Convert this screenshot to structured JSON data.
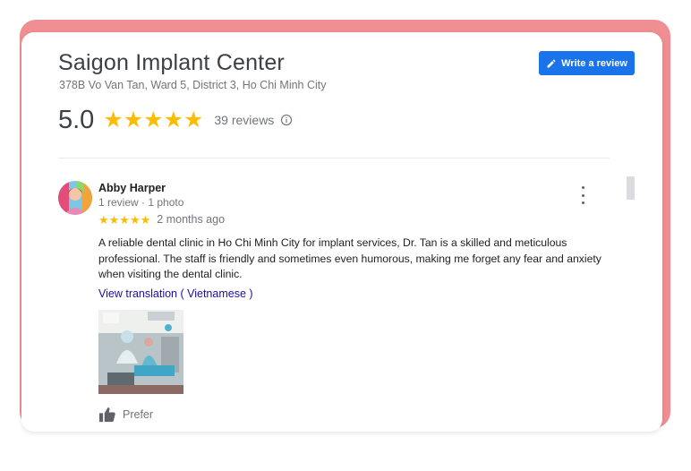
{
  "business": {
    "name": "Saigon Implant Center",
    "address": "378B Vo Van Tan, Ward 5, District 3, Ho Chi Minh City",
    "rating": "5.0",
    "stars": "★★★★★",
    "review_count": "39 reviews",
    "write_review_label": "Write a review"
  },
  "review": {
    "author": "Abby Harper",
    "meta": "1 review · 1 photo",
    "stars": "★★★★★",
    "rating_value": 5,
    "date": "2 months ago",
    "text": "A reliable dental clinic in Ho Chi Minh City for implant services, Dr. Tan is a skilled and meticulous professional. The staff is friendly and sometimes even humorous, making me forget any fear and anxiety when visiting the dental clinic.",
    "translate_link": "View translation ( Vietnamese )",
    "like_label": "Prefer"
  },
  "icons": {
    "write": "pencil-icon",
    "info": "info-icon",
    "menu": "more-vert-icon",
    "like": "thumb-up-icon"
  },
  "colors": {
    "accent": "#1a73e8",
    "star": "#fbbc04",
    "link": "#1a0dab",
    "frame": "#ef8f93"
  }
}
